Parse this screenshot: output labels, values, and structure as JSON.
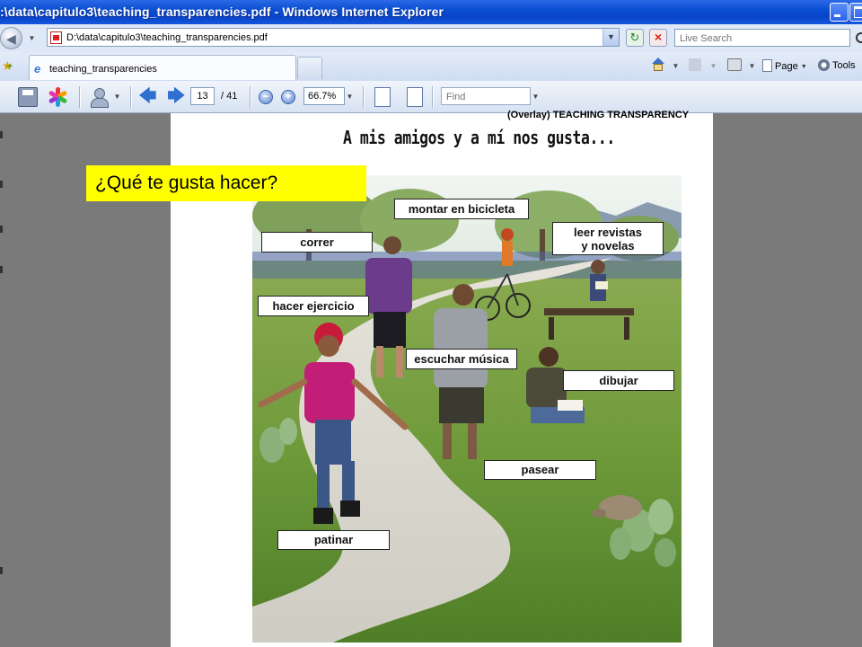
{
  "window": {
    "title": ":\\data\\capitulo3\\teaching_transparencies.pdf - Windows Internet Explorer"
  },
  "address_bar": {
    "url": "D:\\data\\capitulo3\\teaching_transparencies.pdf",
    "search_placeholder": "Live Search"
  },
  "tabs": [
    {
      "label": "teaching_transparencies"
    }
  ],
  "command_bar": {
    "page_label": "Page",
    "tools_label": "Tools"
  },
  "pdf_toolbar": {
    "current_page": "13",
    "total_pages": "/ 41",
    "zoom": "66.7%",
    "find_placeholder": "Find"
  },
  "document": {
    "overline": "(Overlay) TEACHING TRANSPARENCY",
    "heading": "A mis amigos y a mí nos gusta...",
    "question": "¿Qué te gusta hacer?",
    "labels": {
      "montar": "montar en bicicleta",
      "correr": "correr",
      "leer": [
        "leer revistas",
        "y novelas"
      ],
      "hacer_ejercicio": "hacer ejercicio",
      "escuchar": "escuchar música",
      "dibujar": "dibujar",
      "pasear": "pasear",
      "patinar": "patinar"
    }
  },
  "colors": {
    "titlebar": "#0a4ed1",
    "question_highlight": "#ffff00",
    "grass": "#5c8a2e",
    "sky": "#eaf2ee"
  }
}
